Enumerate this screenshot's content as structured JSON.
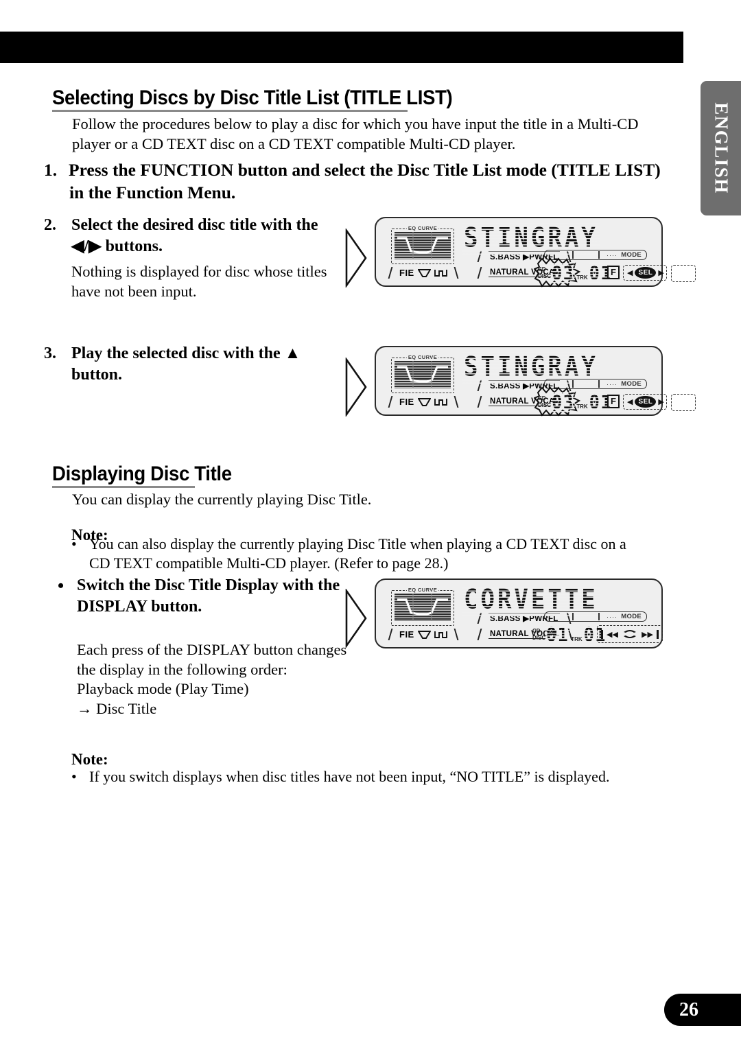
{
  "page": {
    "number": "26",
    "language_tab": "ENGLISH"
  },
  "sections": [
    {
      "heading": "Selecting Discs by Disc Title List (TITLE LIST)",
      "intro": "Follow the procedures below to play a disc for which you have input the title in a Multi-CD player or a CD TEXT disc on a CD TEXT compatible Multi-CD player."
    },
    {
      "heading": "Displaying Disc Title",
      "intro": "You can display the currently playing Disc Title."
    }
  ],
  "steps": {
    "step1_num": "1.",
    "step1_line1": "Press the FUNCTION button and select the Disc Title List mode (TITLE LIST)",
    "step1_line2": "in the Function Menu.",
    "step2_num": "2.",
    "step2_text": "Select the desired disc title with the ◀/▶ buttons.",
    "step2_note": "Nothing is displayed for disc whose titles have not been input.",
    "step3_num": "3.",
    "step3_text": "Play the selected disc with the ▲ button."
  },
  "notes": {
    "label_1": "Note:",
    "bullet_1": "•",
    "item_1": "You can also display the currently playing Disc Title when playing a CD TEXT disc on a CD TEXT compatible Multi-CD player. (Refer to page 28.)",
    "label_2": "Note:",
    "bullet_2": "•",
    "item_2": "If you switch displays when disc titles have not been input, “NO TITLE” is displayed."
  },
  "display_section": {
    "bullet": "•",
    "bold_text": "Switch the Disc Title Display with the DISPLAY button.",
    "body_text": "Each press of the DISPLAY button changes the display in the following order:",
    "order_line1": "Playback mode (Play Time)",
    "order_line2": "→ Disc Title"
  },
  "lcd_displays": [
    {
      "id": "lcd-stingray-1",
      "eq_label": "EQ CURVE",
      "fie_label": "FIE",
      "tag_sbass": "S.BASS ▶PWRFL",
      "tag_natural": "NATURAL  VOCAL",
      "title": "STINGRAY",
      "mode_label": "MODE",
      "mode_dots": "····",
      "label_disc_top": "CD",
      "label_disc_bottom": "DISC",
      "disc_number": "03",
      "label_track": "TRK",
      "track_number": "01",
      "indicator_f": "F",
      "sel_label": "SEL",
      "sel_arrow_left": "◀",
      "sel_arrow_right": "▶",
      "disc_flashing": true
    },
    {
      "id": "lcd-stingray-2",
      "eq_label": "EQ CURVE",
      "fie_label": "FIE",
      "tag_sbass": "S.BASS ▶PWRFL",
      "tag_natural": "NATURAL  VOCAL",
      "title": "STINGRAY",
      "mode_label": "MODE",
      "mode_dots": "····",
      "label_disc_top": "CD",
      "label_disc_bottom": "DISC",
      "disc_number": "03",
      "label_track": "TRK",
      "track_number": "01",
      "indicator_f": "F",
      "sel_label": "SEL",
      "sel_arrow_left": "◀",
      "sel_arrow_right": "▶",
      "disc_flashing": true
    },
    {
      "id": "lcd-corvette",
      "eq_label": "EQ CURVE",
      "fie_label": "FIE",
      "tag_sbass": "S.BASS ▶PWRFL",
      "tag_natural": "NATURAL  VOCAL",
      "title": "CORVETTE",
      "mode_label": "MODE",
      "mode_dots": "····",
      "label_disc_top": "CD",
      "label_disc_bottom": "DISC",
      "disc_number": "01",
      "label_track": "TRK",
      "track_number": "01",
      "nav_prev": "◀◀",
      "nav_next": "▶▶",
      "disc_flashing": false
    }
  ]
}
